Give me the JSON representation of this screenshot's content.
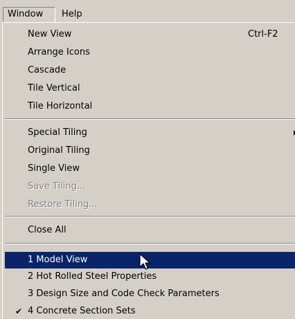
{
  "menubar": {
    "window_label": "Window",
    "help_label": "Help"
  },
  "menu": {
    "new_view": "New View",
    "new_view_shortcut": "Ctrl-F2",
    "arrange_icons": "Arrange Icons",
    "cascade": "Cascade",
    "tile_vertical": "Tile Vertical",
    "tile_horizontal": "Tile Horizontal",
    "special_tiling": "Special Tiling",
    "original_tiling": "Original Tiling",
    "single_view": "Single View",
    "save_tiling": "Save Tiling...",
    "restore_tiling": "Restore Tiling...",
    "close_all": "Close All",
    "windows": [
      "1 Model View",
      "2 Hot Rolled Steel Properties",
      "3 Design Size and Code Check Parameters",
      "4 Concrete Section Sets"
    ],
    "check_glyph": "✔",
    "submenu_icon": "chevron-right-icon",
    "colors": {
      "highlight": "#0a246a",
      "background": "#d4d0c8",
      "disabled_text": "#808080"
    }
  }
}
